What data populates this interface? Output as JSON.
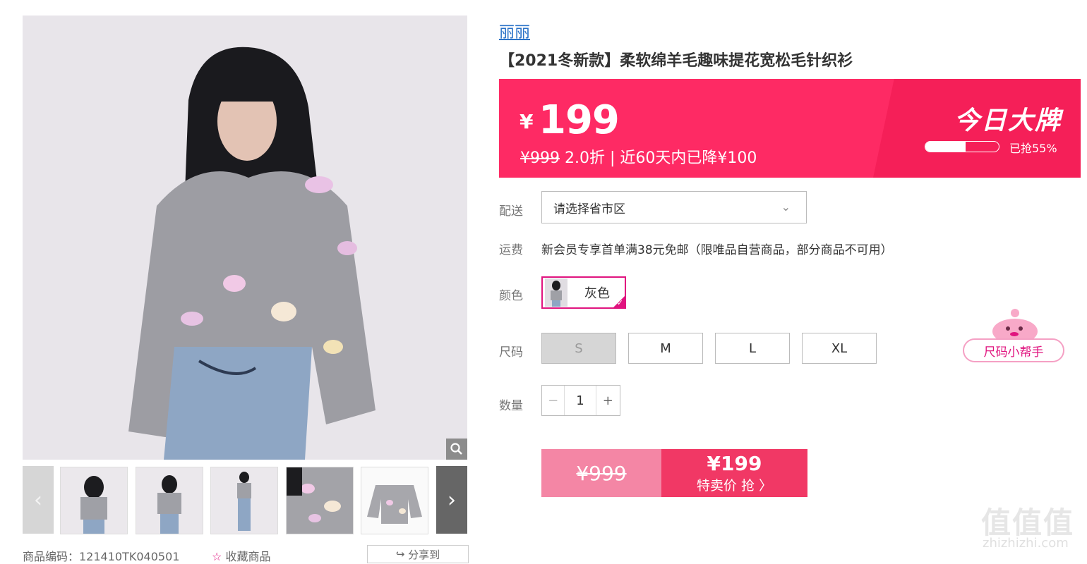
{
  "brand": "丽丽",
  "product_title": "【2021冬新款】柔软绵羊毛趣味提花宽松毛针织衫",
  "price_banner": {
    "currency": "¥",
    "price": "199",
    "original_price": "¥999",
    "discount_text": "2.0折 | 近60天内已降¥100",
    "badge": "今日大牌",
    "sold_percent": 0.55,
    "sold_text": "已抢55%"
  },
  "delivery": {
    "label": "配送",
    "placeholder": "请选择省市区"
  },
  "freight": {
    "label": "运费",
    "text": "新会员专享首单满38元免邮（限唯品自营商品，部分商品不可用）"
  },
  "color": {
    "label": "颜色",
    "selected": "灰色"
  },
  "size": {
    "label": "尺码",
    "options": [
      "S",
      "M",
      "L",
      "XL"
    ],
    "helper": "尺码小帮手"
  },
  "quantity": {
    "label": "数量",
    "minus": "−",
    "value": "1",
    "plus": "+"
  },
  "buy": {
    "original": "¥999",
    "price": "¥199",
    "action": "特卖价 抢 〉"
  },
  "footer": {
    "product_code": "商品编码：121410TK040501",
    "favorite": "收藏商品",
    "share": "分享到"
  },
  "watermark": {
    "main": "值值值",
    "site": "zhizhizhi.com"
  },
  "colors": {
    "accent": "#fe2a64",
    "brand_blue": "#2a72c7",
    "select_border": "#e0147f"
  }
}
